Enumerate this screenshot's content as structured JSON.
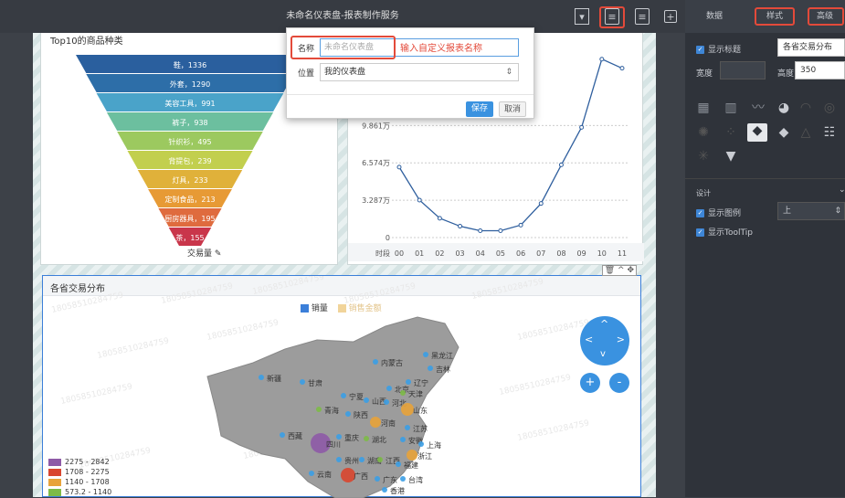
{
  "topbar": {
    "title": "未命名仪表盘-报表制作服务"
  },
  "dialog": {
    "name_label": "名称",
    "name_placeholder": "未命名仪表盘",
    "annotation": "输入自定义报表名称",
    "location_label": "位置",
    "location_value": "我的仪表盘",
    "save_label": "保存",
    "cancel_label": "取消"
  },
  "funnel": {
    "title": "Top10的商品种类",
    "footer": "交易量",
    "items": [
      {
        "label": "鞋，1336",
        "color": "#2a5f9e"
      },
      {
        "label": "外套，1290",
        "color": "#2d6ea8"
      },
      {
        "label": "美容工具，991",
        "color": "#4aa3c9"
      },
      {
        "label": "裤子，938",
        "color": "#6cbf9f"
      },
      {
        "label": "针织衫，495",
        "color": "#9cc95f"
      },
      {
        "label": "背提包，239",
        "color": "#c2cf4e"
      },
      {
        "label": "灯具，233",
        "color": "#e0b13a"
      },
      {
        "label": "定制食品，213",
        "color": "#e79a35"
      },
      {
        "label": "厨房器具，195",
        "color": "#df6b3e"
      },
      {
        "label": "茶，155",
        "color": "#c9364b"
      }
    ]
  },
  "chart_data": {
    "type": "line",
    "x": [
      "00",
      "01",
      "02",
      "03",
      "04",
      "05",
      "06",
      "07",
      "08",
      "09",
      "10",
      "11"
    ],
    "xlabel": "时段",
    "yticks": [
      "0",
      "3.287万",
      "6.574万",
      "9.861万"
    ],
    "ylim": [
      0,
      16.4
    ],
    "series": [
      {
        "values": [
          6.2,
          3.3,
          1.7,
          1.0,
          0.6,
          0.6,
          1.1,
          3.0,
          6.4,
          9.7,
          15.7,
          14.9
        ]
      }
    ]
  },
  "map": {
    "title": "各省交易分布",
    "legend_sales": "销量",
    "legend_amount": "销售金额",
    "watermark": "18058510284759",
    "provinces": [
      "黑龙江",
      "吉林",
      "内蒙古",
      "辽宁",
      "北京",
      "天津",
      "新疆",
      "甘肃",
      "宁夏",
      "山西",
      "河北",
      "山东",
      "青海",
      "陕西",
      "河南",
      "江苏",
      "西藏",
      "四川",
      "重庆",
      "湖北",
      "安徽",
      "上海",
      "浙江",
      "湖南",
      "江西",
      "贵州",
      "福建",
      "云南",
      "广西",
      "广东",
      "台湾",
      "香港"
    ],
    "ranges": [
      {
        "label": "2275 - 2842",
        "color": "#8e5aa7"
      },
      {
        "label": "1708 - 2275",
        "color": "#d9462f"
      },
      {
        "label": "1140 - 1708",
        "color": "#e8a33a"
      },
      {
        "label": "573.2 - 1140",
        "color": "#7dbb47"
      }
    ]
  },
  "right": {
    "tab_data": "数据",
    "tab_style": "样式",
    "tab_advanced": "高级",
    "show_title_label": "显示标题",
    "title_value": "各省交易分布",
    "width_label": "宽度",
    "height_label": "高度",
    "height_value": "350",
    "design_label": "设计",
    "show_legend_label": "显示图例",
    "legend_pos_value": "上",
    "show_tooltip_label": "显示ToolTip"
  }
}
